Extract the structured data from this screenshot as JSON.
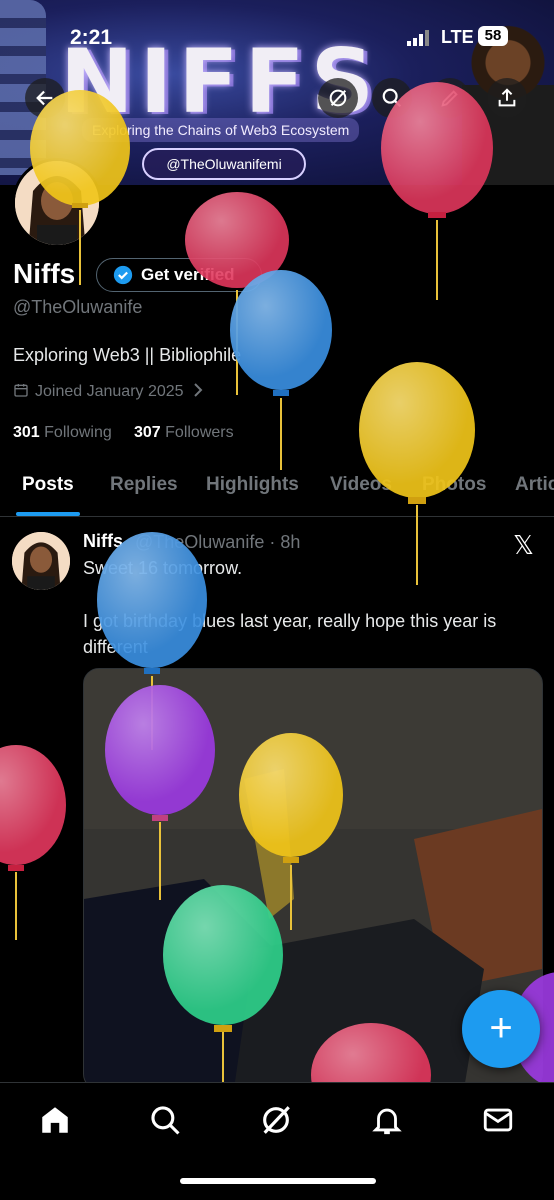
{
  "status_bar": {
    "time": "2:21",
    "network": "LTE",
    "battery": "58"
  },
  "banner": {
    "title": "NIFFS",
    "subtitle": "Exploring the Chains of Web3 Ecosystem",
    "handle": "@TheOluwanifemi"
  },
  "profile": {
    "name": "Niffs",
    "verify_label": "Get verified",
    "handle": "@TheOluwanife",
    "bio": "Exploring Web3 || Bibliophile",
    "joined": "Joined January 2025",
    "following_count": "301",
    "following_label": "Following",
    "followers_count": "307",
    "followers_label": "Followers"
  },
  "tabs": [
    "Posts",
    "Replies",
    "Highlights",
    "Videos",
    "Photos",
    "Articles"
  ],
  "post": {
    "author": "Niffs",
    "handle_time": "@TheOluwanife · 8h",
    "line1": "Sweet 16 tomorrow.",
    "text": "I got birthday blues last year, really hope this year is different"
  },
  "fab_label": "+",
  "colors": {
    "accent": "#1d9bf0",
    "background": "#000000",
    "muted": "#71767b"
  },
  "icons": [
    "back-arrow-icon",
    "grok-icon",
    "search-icon",
    "edit-icon",
    "share-icon",
    "calendar-icon",
    "chevron-right-icon",
    "x-logo-icon",
    "home-icon",
    "explore-icon",
    "grok-nav-icon",
    "bell-icon",
    "mail-icon"
  ]
}
